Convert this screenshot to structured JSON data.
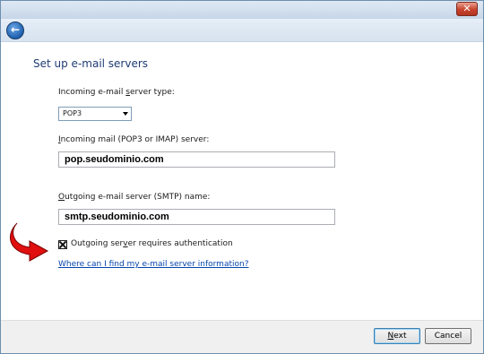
{
  "window": {
    "close_symbol": "✕"
  },
  "nav": {
    "back_symbol": "←"
  },
  "page": {
    "title": "Set up e-mail servers"
  },
  "form": {
    "server_type_label_pre": "Incoming e-mail ",
    "server_type_label_u": "s",
    "server_type_label_post": "erver type:",
    "server_type_value": "POP3",
    "incoming_label_u": "I",
    "incoming_label_post": "ncoming mail (POP3 or IMAP) server:",
    "incoming_value": "pop.seudominio.com",
    "outgoing_label_u": "O",
    "outgoing_label_post": "utgoing e-mail server (SMTP) name:",
    "outgoing_value": "smtp.seudominio.com",
    "auth_label_pre": "Outgoing ser",
    "auth_label_u": "v",
    "auth_label_post": "er requires authentication",
    "auth_checked": true,
    "help_link": "Where can I find my e-mail server information?"
  },
  "footer": {
    "next_u": "N",
    "next_post": "ext",
    "cancel": "Cancel"
  },
  "colors": {
    "arrow": "#e01010",
    "title": "#1e3b74",
    "link": "#0645ad"
  }
}
